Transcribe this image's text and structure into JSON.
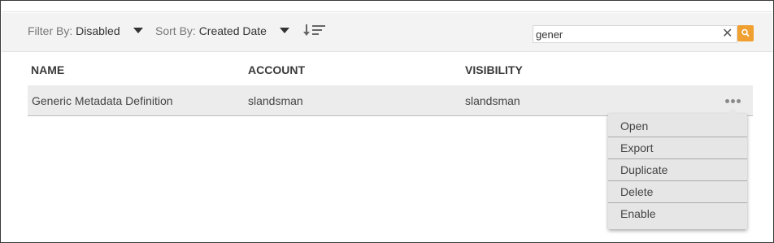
{
  "toolbar": {
    "filter_label": "Filter By:",
    "filter_value": "Disabled",
    "sort_label": "Sort By:",
    "sort_value": "Created Date"
  },
  "search": {
    "value": "gener",
    "clear_glyph": "✕"
  },
  "table": {
    "columns": [
      "NAME",
      "ACCOUNT",
      "VISIBILITY"
    ],
    "rows": [
      {
        "name": "Generic Metadata Definition",
        "account": "slandsman",
        "visibility": "slandsman"
      }
    ]
  },
  "context_menu": {
    "items": [
      "Open",
      "Export",
      "Duplicate",
      "Delete",
      "Enable"
    ]
  },
  "colors": {
    "search_button": "#f0a030",
    "toolbar_bg": "#f3f3f3",
    "row_bg": "#ececec",
    "menu_bg": "#e6e6e6"
  },
  "icons": {
    "filter_caret": "caret-down-icon",
    "sort_caret": "caret-down-icon",
    "sort_order": "sort-descending-icon",
    "clear": "close-icon",
    "search": "search-icon",
    "row_actions": "more-horizontal-icon"
  }
}
